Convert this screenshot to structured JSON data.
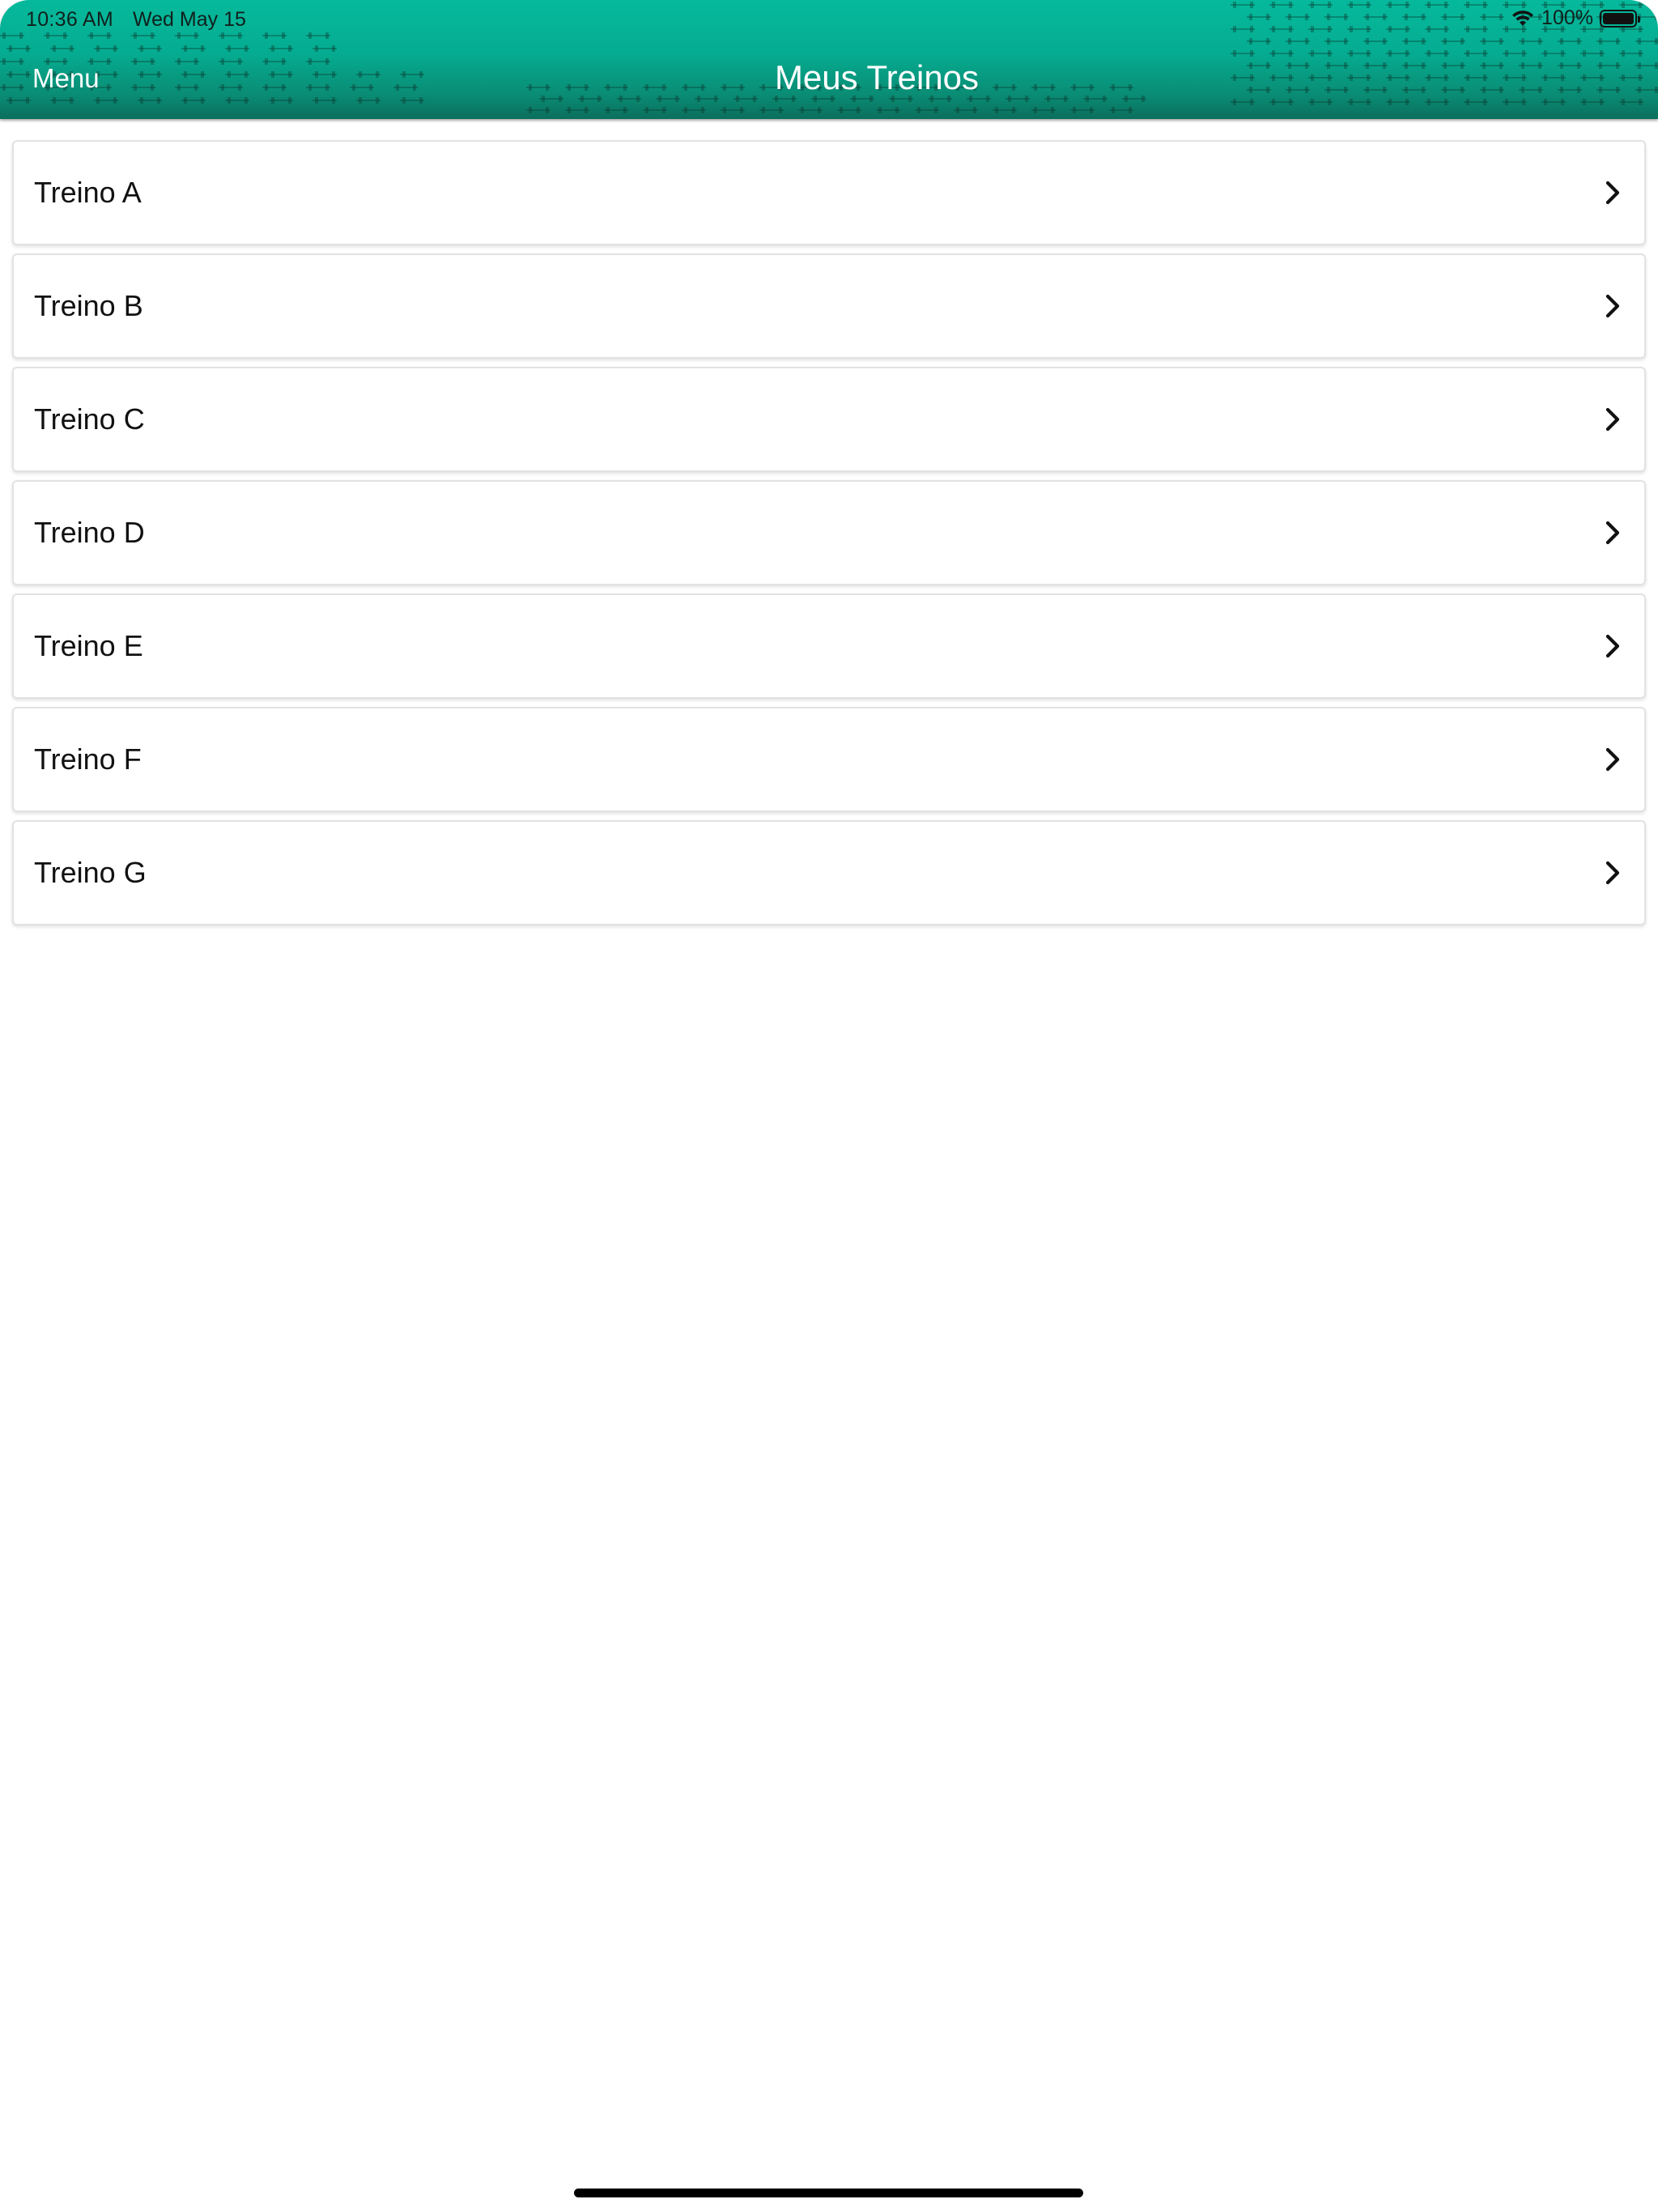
{
  "status_bar": {
    "time": "10:36 AM",
    "date": "Wed May 15",
    "battery": "100%"
  },
  "nav": {
    "menu_label": "Menu",
    "title": "Meus Treinos"
  },
  "workouts": [
    {
      "label": "Treino A"
    },
    {
      "label": "Treino B"
    },
    {
      "label": "Treino C"
    },
    {
      "label": "Treino D"
    },
    {
      "label": "Treino E"
    },
    {
      "label": "Treino F"
    },
    {
      "label": "Treino G"
    }
  ],
  "icons": {
    "row_chevron": "chevron-right-icon",
    "wifi": "wifi-icon",
    "battery": "battery-icon"
  },
  "colors": {
    "header_top": "#06b99c",
    "header_bottom": "#0b6f5d"
  }
}
